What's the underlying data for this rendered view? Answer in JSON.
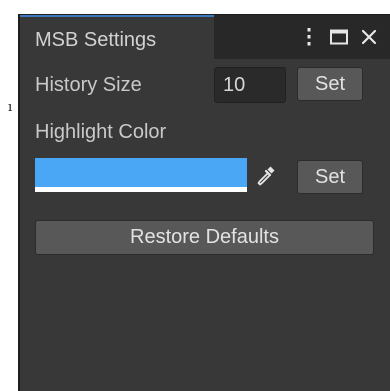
{
  "window": {
    "tab_title": "MSB Settings"
  },
  "tab_actions": {
    "menu_icon": "vertical-ellipsis-icon",
    "maximize_icon": "maximize-icon",
    "close_icon": "close-icon"
  },
  "history": {
    "label": "History Size",
    "value": "10",
    "set_label": "Set"
  },
  "highlight": {
    "label": "Highlight Color",
    "color": "#4aa7f6",
    "picker_icon": "eyedropper-icon",
    "set_label": "Set"
  },
  "restore_label": "Restore Defaults",
  "stray_mark": "ı"
}
